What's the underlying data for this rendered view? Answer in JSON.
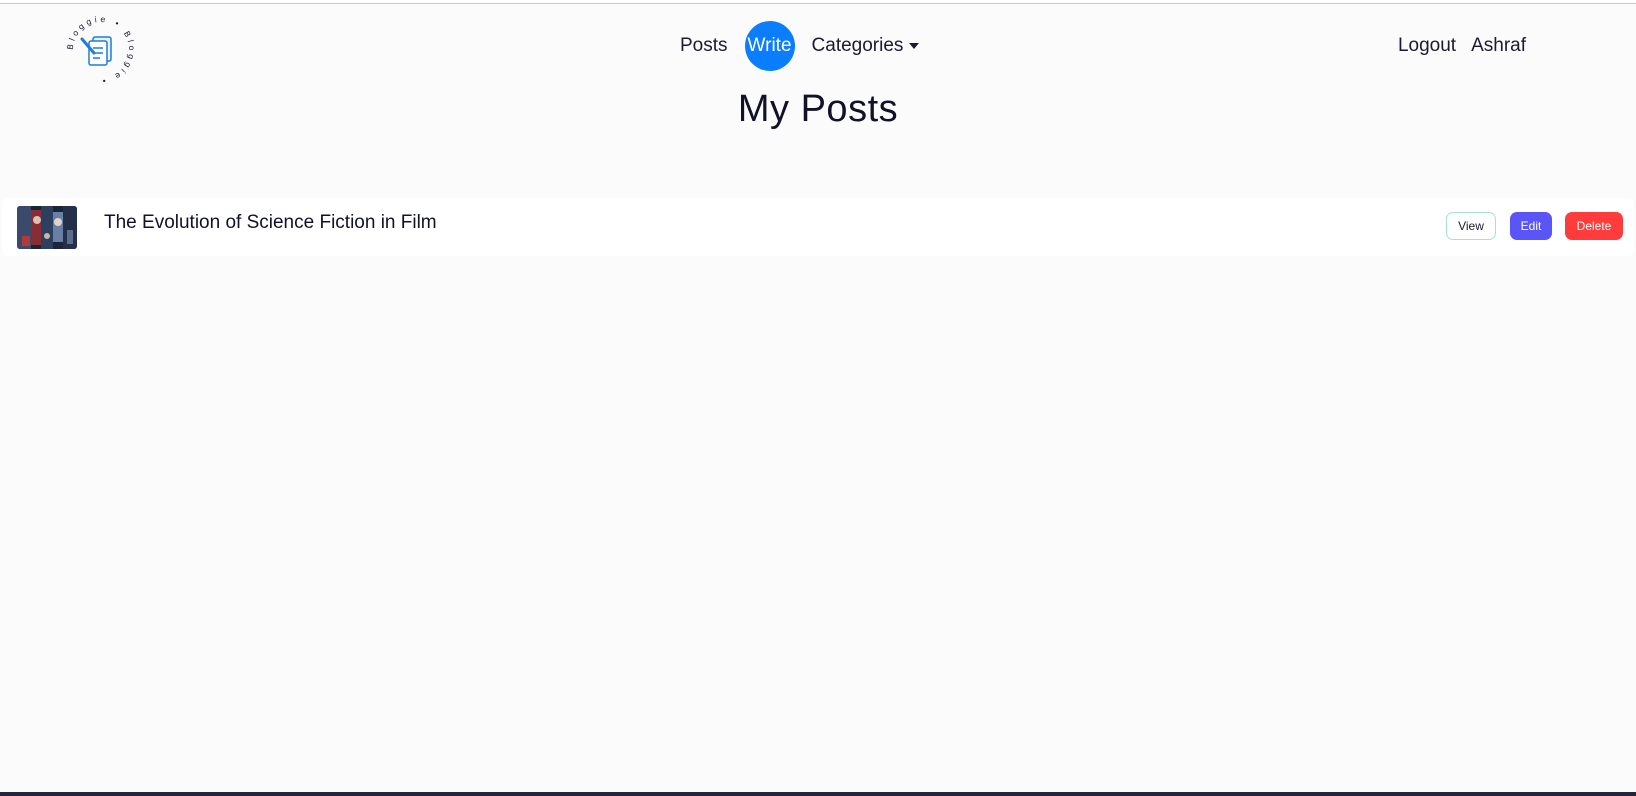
{
  "brand": {
    "logo_text": "Bloggie"
  },
  "nav": {
    "posts_label": "Posts",
    "write_label": "Write",
    "categories_label": "Categories",
    "logout_label": "Logout",
    "user_label": "Ashraf"
  },
  "page": {
    "title": "My Posts"
  },
  "posts": [
    {
      "title": "The Evolution of Science Fiction in Film",
      "view_label": "View",
      "edit_label": "Edit",
      "delete_label": "Delete"
    }
  ],
  "colors": {
    "accent": "#0b7dff",
    "edit": "#5a55f7",
    "delete": "#ff3b3b"
  },
  "icons": {
    "logo": "document-pen-icon",
    "caret": "caret-down-icon"
  }
}
